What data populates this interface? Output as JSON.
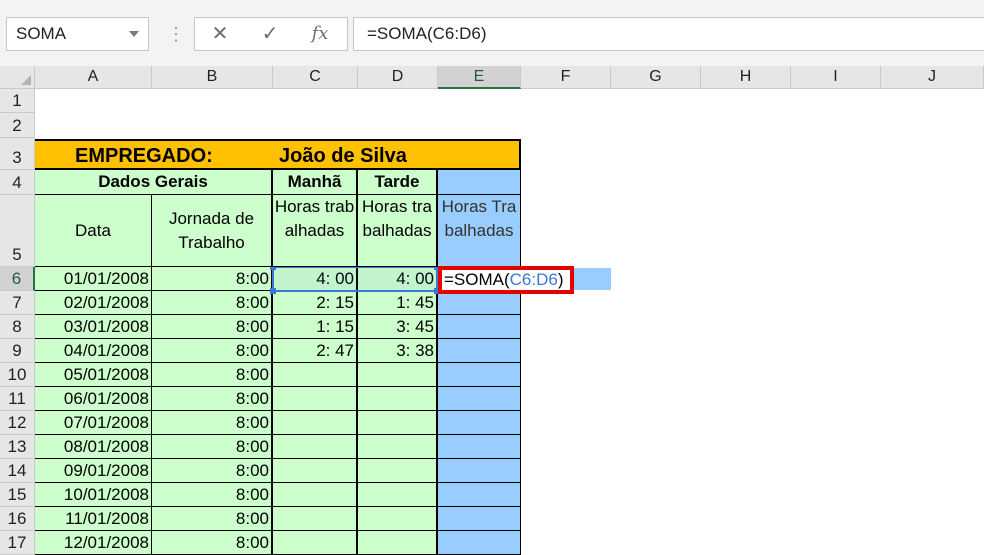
{
  "name_box": {
    "value": "SOMA"
  },
  "formula_bar": {
    "cancel_icon": "✕",
    "enter_icon": "✓",
    "fx_label": "fx",
    "value": "=SOMA(C6:D6)"
  },
  "columns": [
    "A",
    "B",
    "C",
    "D",
    "E",
    "F",
    "G",
    "H",
    "I",
    "J"
  ],
  "rows": [
    "1",
    "2",
    "3",
    "4",
    "5",
    "6",
    "7",
    "8",
    "9",
    "10",
    "11",
    "12",
    "13",
    "14",
    "15",
    "16",
    "17"
  ],
  "sheet": {
    "title_label": "EMPREGADO:",
    "title_name": "João de Silva",
    "group_dados": "Dados Gerais",
    "group_manha": "Manhã",
    "group_tarde": "Tarde",
    "hdr_data": "Data",
    "hdr_jornada": "Jornada de Trabalho",
    "hdr_manha": "Horas trabalhadas",
    "hdr_tarde": "Horas trabalhadas",
    "hdr_total": "Horas Trabalhadas",
    "editing_formula_prefix": "=SOMA(",
    "editing_formula_ref": "C6:D6",
    "editing_formula_suffix": ")",
    "data_rows": [
      {
        "date": "01/01/2008",
        "jornada": "8:00",
        "manha": "4: 00",
        "tarde": "4: 00"
      },
      {
        "date": "02/01/2008",
        "jornada": "8:00",
        "manha": "2: 15",
        "tarde": "1: 45"
      },
      {
        "date": "03/01/2008",
        "jornada": "8:00",
        "manha": "1: 15",
        "tarde": "3: 45"
      },
      {
        "date": "04/01/2008",
        "jornada": "8:00",
        "manha": "2: 47",
        "tarde": "3: 38"
      },
      {
        "date": "05/01/2008",
        "jornada": "8:00",
        "manha": "",
        "tarde": ""
      },
      {
        "date": "06/01/2008",
        "jornada": "8:00",
        "manha": "",
        "tarde": ""
      },
      {
        "date": "07/01/2008",
        "jornada": "8:00",
        "manha": "",
        "tarde": ""
      },
      {
        "date": "08/01/2008",
        "jornada": "8:00",
        "manha": "",
        "tarde": ""
      },
      {
        "date": "09/01/2008",
        "jornada": "8:00",
        "manha": "",
        "tarde": ""
      },
      {
        "date": "10/01/2008",
        "jornada": "8:00",
        "manha": "",
        "tarde": ""
      },
      {
        "date": "11/01/2008",
        "jornada": "8:00",
        "manha": "",
        "tarde": ""
      },
      {
        "date": "12/01/2008",
        "jornada": "8:00",
        "manha": "",
        "tarde": ""
      }
    ]
  },
  "colors": {
    "title_fill": "#ffc000",
    "green_fill": "#ccffcc",
    "blue_fill": "#99ccff",
    "highlight_border": "#e60000",
    "range_border": "#3c78d8",
    "selection_green": "#217346"
  }
}
